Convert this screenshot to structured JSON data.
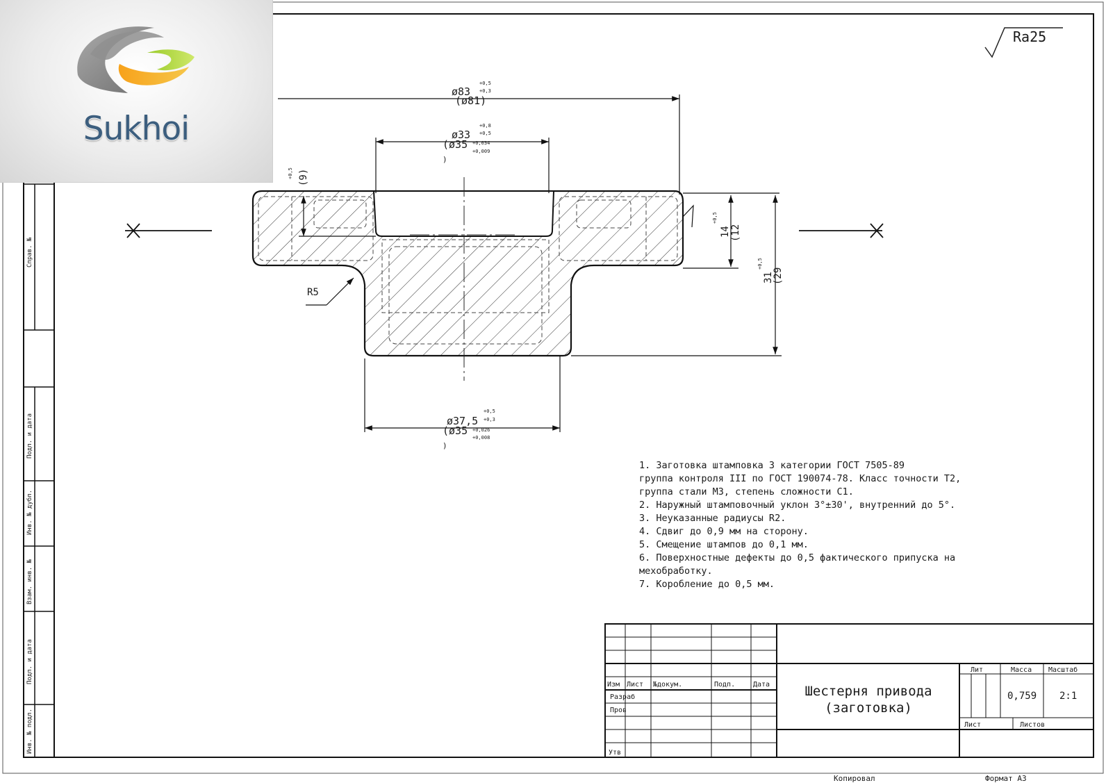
{
  "logo": {
    "brand": "Sukhoi",
    "icon": "sukhoi-swirl-icon"
  },
  "roughness": "Ra25",
  "dimensions": {
    "outer_diameter": "ø83",
    "outer_diameter_ref": "(ø81)",
    "outer_tol_upper": "+0,5",
    "outer_tol_lower": "+0,3",
    "bore_diameter": "ø33",
    "bore_diameter_ref": "(ø35",
    "bore_tol_upper": "+0,8",
    "bore_tol_lower": "+0,5",
    "bore_tol_ref_upper": "+0,034",
    "bore_tol_ref_lower": "+0,009",
    "hub_diameter": "ø37,5",
    "hub_diameter_ref": "(ø35",
    "hub_tol_upper": "+0,5",
    "hub_tol_lower": "+0,3",
    "hub_tol_ref_upper": "+0,026",
    "hub_tol_ref_lower": "+0,008",
    "recess_depth": "(9)",
    "recess_tol": "+0,5",
    "flange_height": "14",
    "flange_height_ref": "(12",
    "flange_tol": "+0,5",
    "total_height": "31",
    "total_height_ref": "(29",
    "total_tol": "+0,5",
    "fillet_radius": "R5",
    "ref_mark": ")"
  },
  "notes": [
    "1. Заготовка штамповка 3 категории ГОСТ 7505-89",
    "группа контроля III по ГОСТ 190074-78. Класс точности Т2,",
    "группа стали М3, степень сложности С1.",
    "2. Наружный штамповочный уклон 3°±30', внутренний до 5°.",
    "3. Неуказанные радиусы R2.",
    "4. Сдвиг до 0,9 мм на сторону.",
    "5. Смещение штампов до 0,1 мм.",
    "6. Поверхностные дефекты до 0,5 фактического припуска на",
    "мехобработку.",
    "7. Коробление до 0,5 мм."
  ],
  "title_block": {
    "title_line1": "Шестерня привода",
    "title_line2": "(заготовка)",
    "col_izm": "Изм",
    "col_list": "Лист",
    "col_ndoc": "№докум.",
    "col_podp": "Подп.",
    "col_data": "Дата",
    "row_razrab": "Разраб",
    "row_prov": "Пров",
    "row_utv": "Утв",
    "lit_label": "Лит",
    "massa_label": "Масса",
    "scale_label": "Масштаб",
    "mass_value": "0,759",
    "scale_value": "2:1",
    "sheet_label": "Лист",
    "sheets_label": "Листов"
  },
  "footer": {
    "copied": "Копировал",
    "format": "Формат А3"
  },
  "side_labels": [
    "Справ. №",
    "Подп. и дата",
    "Инв. № дубл.",
    "Взам. инв. №",
    "Подп. и дата",
    "Инв. № подл."
  ]
}
